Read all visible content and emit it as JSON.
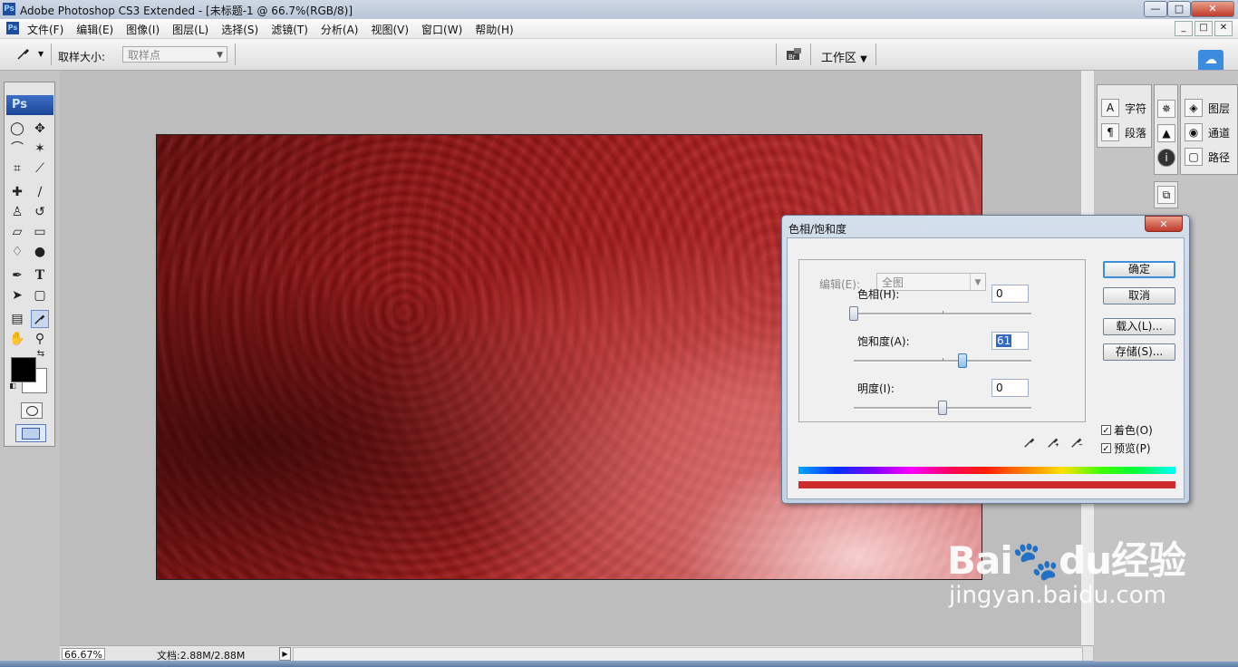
{
  "window": {
    "app_icon": "Ps",
    "title": "Adobe Photoshop CS3 Extended - [未标题-1 @ 66.7%(RGB/8)]",
    "controls": [
      "—",
      "□",
      "✕"
    ]
  },
  "menu": {
    "ps_icon": "Ps",
    "items": [
      "文件(F)",
      "编辑(E)",
      "图像(I)",
      "图层(L)",
      "选择(S)",
      "滤镜(T)",
      "分析(A)",
      "视图(V)",
      "窗口(W)",
      "帮助(H)"
    ],
    "doc_controls": [
      "_",
      "□",
      "✕"
    ]
  },
  "options": {
    "sample_size_label": "取样大小:",
    "sample_size_value": "取样点",
    "workspace_label": "工作区",
    "workspace_arrow": "▼",
    "tool_icon": "eyedropper-icon"
  },
  "toolbox": {
    "logo": "Ps",
    "foreground_color": "#000000",
    "background_color": "#ffffff",
    "type_tool_glyph": "T"
  },
  "panels": {
    "col1": [
      {
        "icon": "character-icon",
        "glyph": "A",
        "label": "字符"
      },
      {
        "icon": "paragraph-icon",
        "glyph": "¶",
        "label": "段落"
      }
    ],
    "col3": [
      {
        "icon": "layers-icon",
        "glyph": "◈",
        "label": "图层"
      },
      {
        "icon": "channels-icon",
        "glyph": "◉",
        "label": "通道"
      },
      {
        "icon": "paths-icon",
        "glyph": "▢",
        "label": "路径"
      }
    ]
  },
  "dialog": {
    "title": "色相/饱和度",
    "close": "✕",
    "edit_label": "编辑(E):",
    "edit_value": "全图",
    "hue_label": "色相(H):",
    "hue_value": "0",
    "saturation_label": "饱和度(A):",
    "saturation_value": "61",
    "lightness_label": "明度(I):",
    "lightness_value": "0",
    "buttons": {
      "ok": "确定",
      "cancel": "取消",
      "load": "载入(L)...",
      "save": "存储(S)..."
    },
    "colorize_label": "着色(O)",
    "colorize_checked": true,
    "preview_label": "预览(P)",
    "preview_checked": true,
    "check_mark": "✓",
    "hue_slider_value": 0,
    "saturation_slider_value": 61,
    "lightness_slider_value": 0
  },
  "status": {
    "zoom": "66.67%",
    "doc_size": "文档:2.88M/2.88M",
    "arrow": "▶"
  },
  "watermark": {
    "brand": "Bai",
    "brand2": "du",
    "brand_cn": "经验",
    "url": "jingyan.baidu.com"
  }
}
